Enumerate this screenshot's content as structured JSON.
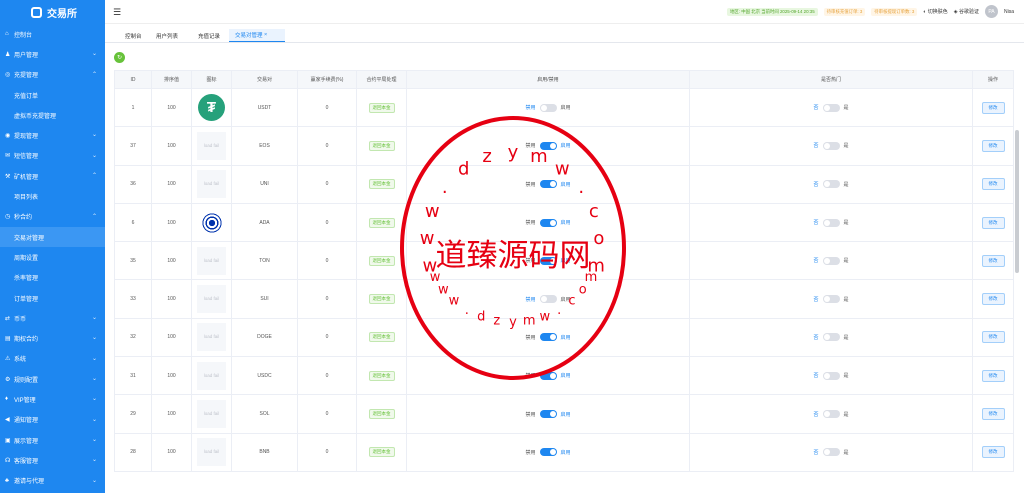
{
  "sidebar": {
    "logo": "交易所",
    "items": [
      {
        "label": "控制台",
        "icon": "home-icon",
        "glyph": "⌂",
        "type": "top"
      },
      {
        "label": "用户管理",
        "icon": "user-icon",
        "glyph": "♟",
        "type": "group"
      },
      {
        "label": "充提管理",
        "icon": "wallet-icon",
        "glyph": "◎",
        "type": "group-open"
      },
      {
        "label": "充值订单",
        "type": "sub"
      },
      {
        "label": "虚拟币充提管理",
        "type": "sub"
      },
      {
        "label": "提现管理",
        "icon": "withdraw-icon",
        "glyph": "◉",
        "type": "group"
      },
      {
        "label": "短信管理",
        "icon": "mail-icon",
        "glyph": "✉",
        "type": "group"
      },
      {
        "label": "矿机管理",
        "icon": "mining-icon",
        "glyph": "⚒",
        "type": "group-open"
      },
      {
        "label": "项目列表",
        "type": "sub"
      },
      {
        "label": "秒合约",
        "icon": "clock-icon",
        "glyph": "◷",
        "type": "group-open"
      },
      {
        "label": "交易对管理",
        "type": "sub-active"
      },
      {
        "label": "周期设置",
        "type": "sub"
      },
      {
        "label": "杀率管理",
        "type": "sub"
      },
      {
        "label": "订单管理",
        "type": "sub"
      },
      {
        "label": "币币",
        "icon": "exchange-icon",
        "glyph": "⇄",
        "type": "group"
      },
      {
        "label": "期权合约",
        "icon": "contract-icon",
        "glyph": "▤",
        "type": "group"
      },
      {
        "label": "系统",
        "icon": "warning-icon",
        "glyph": "⚠",
        "type": "group"
      },
      {
        "label": "规则配置",
        "icon": "settings-icon",
        "glyph": "⚙",
        "type": "group"
      },
      {
        "label": "VIP管理",
        "icon": "vip-icon",
        "glyph": "♦",
        "type": "group"
      },
      {
        "label": "通知管理",
        "icon": "megaphone-icon",
        "glyph": "◀",
        "type": "group"
      },
      {
        "label": "展示管理",
        "icon": "display-icon",
        "glyph": "▣",
        "type": "group"
      },
      {
        "label": "客服管理",
        "icon": "headset-icon",
        "glyph": "☊",
        "type": "group"
      },
      {
        "label": "邀请与代理",
        "icon": "invite-icon",
        "glyph": "♣",
        "type": "group"
      }
    ]
  },
  "header": {
    "menu_glyph": "☰",
    "badges": [
      {
        "text": "地区: 中国 北京 当前时间 2025-09-14 20:35",
        "color": "green"
      },
      {
        "text": "待审核充值订单: 3",
        "color": "orange"
      },
      {
        "text": "待审核提现订单数: 3",
        "color": "orange"
      }
    ],
    "skin_label": "切换肤色",
    "verify_label": "谷歌验证",
    "avatar_text": "PA",
    "user_name": "Nisa"
  },
  "tabs": [
    {
      "label": "控制台",
      "active": false
    },
    {
      "label": "用户列表",
      "active": false
    },
    {
      "label": "充值记录",
      "active": false
    },
    {
      "label": "交易对管理",
      "active": true,
      "close": "×"
    }
  ],
  "toolbar": {
    "refresh_glyph": "↻"
  },
  "table": {
    "headers": [
      "ID",
      "排序值",
      "图标",
      "交易对",
      "赢家手续费(%)",
      "合约平局处理",
      "启用/禁用",
      "是否热门",
      "操作"
    ],
    "enable_off_label": "禁用",
    "enable_on_label": "启用",
    "hot_off_label": "否",
    "hot_on_label": "是",
    "edit_label": "修改",
    "img_placeholder": "load fail",
    "rows": [
      {
        "id": "1",
        "sort": "100",
        "icon": "usdt",
        "pair": "USDT",
        "fee": "0",
        "draw": "退回本金",
        "enabled": false,
        "hot": false
      },
      {
        "id": "37",
        "sort": "100",
        "icon": "fail",
        "pair": "EOS",
        "fee": "0",
        "draw": "退回本金",
        "enabled": true,
        "hot": false
      },
      {
        "id": "36",
        "sort": "100",
        "icon": "fail",
        "pair": "UNI",
        "fee": "0",
        "draw": "退回本金",
        "enabled": true,
        "hot": false
      },
      {
        "id": "6",
        "sort": "100",
        "icon": "ada",
        "pair": "ADA",
        "fee": "0",
        "draw": "退回本金",
        "enabled": true,
        "hot": false
      },
      {
        "id": "35",
        "sort": "100",
        "icon": "fail",
        "pair": "TON",
        "fee": "0",
        "draw": "退回本金",
        "enabled": true,
        "hot": false
      },
      {
        "id": "33",
        "sort": "100",
        "icon": "fail",
        "pair": "SUI",
        "fee": "0",
        "draw": "退回本金",
        "enabled": false,
        "hot": false
      },
      {
        "id": "32",
        "sort": "100",
        "icon": "fail",
        "pair": "DOGE",
        "fee": "0",
        "draw": "退回本金",
        "enabled": true,
        "hot": false
      },
      {
        "id": "31",
        "sort": "100",
        "icon": "fail",
        "pair": "USDC",
        "fee": "0",
        "draw": "退回本金",
        "enabled": true,
        "hot": false
      },
      {
        "id": "29",
        "sort": "100",
        "icon": "fail",
        "pair": "SOL",
        "fee": "0",
        "draw": "退回本金",
        "enabled": true,
        "hot": false
      },
      {
        "id": "28",
        "sort": "100",
        "icon": "fail",
        "pair": "BNB",
        "fee": "0",
        "draw": "退回本金",
        "enabled": true,
        "hot": false
      }
    ]
  },
  "watermark": {
    "center_text": "道臻源码网",
    "ring_text": "www.dzymw.com",
    "color": "#e60012"
  }
}
